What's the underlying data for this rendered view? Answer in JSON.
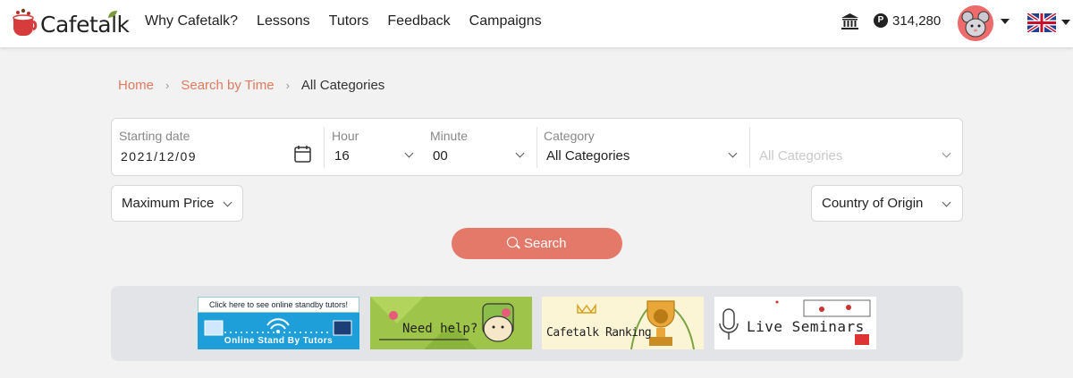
{
  "header": {
    "logo_text": "Cafetalk",
    "nav": [
      "Why Cafetalk?",
      "Lessons",
      "Tutors",
      "Feedback",
      "Campaigns"
    ],
    "points": "314,280",
    "points_symbol": "P"
  },
  "breadcrumb": {
    "home": "Home",
    "search_by_time": "Search by Time",
    "current": "All Categories"
  },
  "search": {
    "starting_date_label": "Starting date",
    "starting_date_value": "2021/12/09",
    "hour_label": "Hour",
    "hour_value": "16",
    "minute_label": "Minute",
    "minute_value": "00",
    "category_label": "Category",
    "category_value": "All Categories",
    "subcategory_placeholder": "All Categories",
    "max_price_label": "Maximum Price",
    "country_label": "Country of Origin",
    "search_button": "Search"
  },
  "banners": {
    "standby_top": "Click here to see online standby tutors!",
    "standby_bottom": "Online Stand By Tutors",
    "need_help": "Need help?",
    "ranking": "Cafetalk Ranking",
    "seminars": "Live Seminars"
  },
  "colors": {
    "accent": "#e4796a",
    "link": "#e07a60",
    "banner_strip": "#e2e4e8"
  }
}
